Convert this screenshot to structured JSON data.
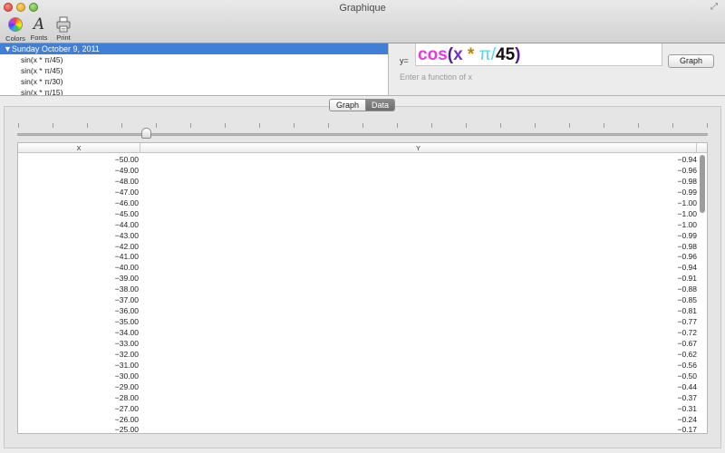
{
  "window": {
    "title": "Graphique"
  },
  "toolbar": {
    "colors_label": "Colors",
    "fonts_label": "Fonts",
    "print_label": "Print",
    "fonts_glyph": "A"
  },
  "history": {
    "group": "▼Sunday October 9, 2011",
    "items": [
      "sin(x * π/45)",
      "sin(x * π/45)",
      "sin(x * π/30)",
      "sin(x * π/15)"
    ]
  },
  "function_input": {
    "prefix": "y=",
    "tokens": [
      "cos",
      "(",
      "x",
      " * ",
      "π",
      "/",
      "45",
      ")"
    ],
    "placeholder": "Enter a function of x"
  },
  "graph_button": "Graph",
  "view_tabs": {
    "graph": "Graph",
    "data": "Data",
    "selected": "Data"
  },
  "table": {
    "headers": [
      "X",
      "Y"
    ],
    "rows": [
      [
        "−50.00",
        "−0.94"
      ],
      [
        "−49.00",
        "−0.96"
      ],
      [
        "−48.00",
        "−0.98"
      ],
      [
        "−47.00",
        "−0.99"
      ],
      [
        "−46.00",
        "−1.00"
      ],
      [
        "−45.00",
        "−1.00"
      ],
      [
        "−44.00",
        "−1.00"
      ],
      [
        "−43.00",
        "−0.99"
      ],
      [
        "−42.00",
        "−0.98"
      ],
      [
        "−41.00",
        "−0.96"
      ],
      [
        "−40.00",
        "−0.94"
      ],
      [
        "−39.00",
        "−0.91"
      ],
      [
        "−38.00",
        "−0.88"
      ],
      [
        "−37.00",
        "−0.85"
      ],
      [
        "−36.00",
        "−0.81"
      ],
      [
        "−35.00",
        "−0.77"
      ],
      [
        "−34.00",
        "−0.72"
      ],
      [
        "−33.00",
        "−0.67"
      ],
      [
        "−32.00",
        "−0.62"
      ],
      [
        "−31.00",
        "−0.56"
      ],
      [
        "−30.00",
        "−0.50"
      ],
      [
        "−29.00",
        "−0.44"
      ],
      [
        "−28.00",
        "−0.37"
      ],
      [
        "−27.00",
        "−0.31"
      ],
      [
        "−26.00",
        "−0.24"
      ],
      [
        "−25.00",
        "−0.17"
      ]
    ]
  },
  "colors": {
    "selection": "#3f7fd6",
    "cos": "#e23be0",
    "x": "#7b2fc7",
    "operator": "#b8860b",
    "pi": "#55d6e8"
  }
}
